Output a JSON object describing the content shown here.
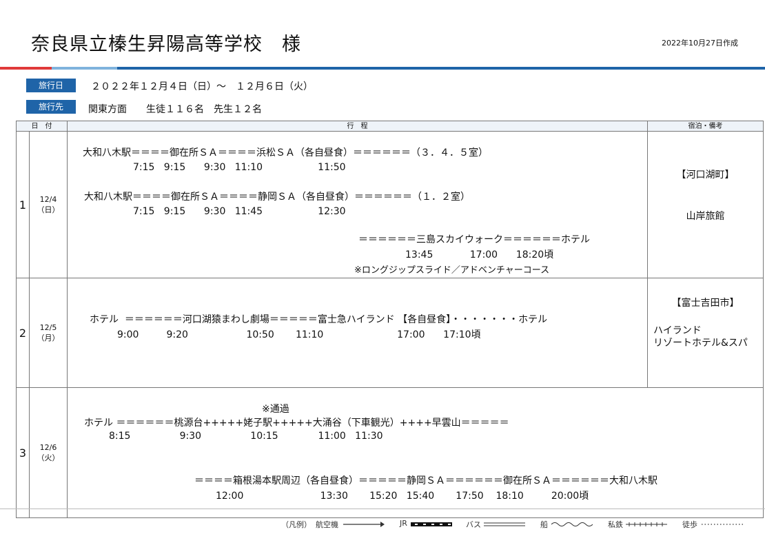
{
  "header": {
    "title": "奈良県立榛生昇陽高等学校　様",
    "created": "2022年10月27日作成"
  },
  "info": {
    "date_label": "旅行日",
    "date_value": "２０２２年１２月４日（日）～　１２月６日（火）",
    "dest_label": "旅行先",
    "dest_value": "関東方面　　生徒１１６名　先生１２名"
  },
  "table": {
    "headers": {
      "date": "日　付",
      "itinerary": "行　程",
      "remarks": "宿泊・備考"
    },
    "rows": [
      {
        "num": "1",
        "date": "12/4",
        "day": "（日）",
        "lines": [
          "大和八木駅＝＝＝＝御在所ＳＡ＝＝＝＝浜松ＳＡ（各自昼食）＝＝＝＝＝＝（３．４．５室）",
          "7:15   9:15      9:30   11:10                  11:50",
          "大和八木駅＝＝＝＝御在所ＳＡ＝＝＝＝静岡ＳＡ（各自昼食）＝＝＝＝＝＝（１．２室）",
          "7:15   9:15      9:30   11:45                  12:30",
          "＝＝＝＝＝＝三島スカイウォーク＝＝＝＝＝＝ホテル",
          "13:45            17:00      18:20頃",
          "※ロングジップスライド／アドベンチャーコース"
        ],
        "remark_area": "【河口湖町】",
        "remark_hotel": "山岸旅館"
      },
      {
        "num": "2",
        "date": "12/5",
        "day": "（月）",
        "lines": [
          "ホテル  ＝＝＝＝＝＝河口湖猿まわし劇場＝＝＝＝＝富士急ハイランド 【各自昼食】・・・・・・・ホテル",
          "9:00         9:20                   10:50       11:10                        17:00      17:10頃"
        ],
        "remark_area": "【富士吉田市】",
        "remark_hotel": "ハイランド\nリゾートホテル&スパ"
      },
      {
        "num": "3",
        "date": "12/6",
        "day": "（火）",
        "lines": [
          "※通過",
          "ホテル ＝＝＝＝＝＝桃源台+++++姥子駅+++++大涌谷（下車観光）++++早雲山＝＝＝＝＝",
          "8:15                9:30                10:15             11:00   11:30",
          "＝＝＝＝箱根湯本駅周辺（各自昼食）＝＝＝＝＝静岡ＳＡ＝＝＝＝＝＝御在所ＳＡ＝＝＝＝＝＝大和八木駅",
          "12:00                         13:30       15:20   15:40       17:50    18:10         20:00頃"
        ],
        "remark_area": "",
        "remark_hotel": ""
      }
    ]
  },
  "legend": {
    "title": "（凡例）",
    "air": "航空機",
    "jr": "JR",
    "bus": "バス",
    "ship": "船",
    "private_rail": "私鉄",
    "walk": "徒歩"
  }
}
